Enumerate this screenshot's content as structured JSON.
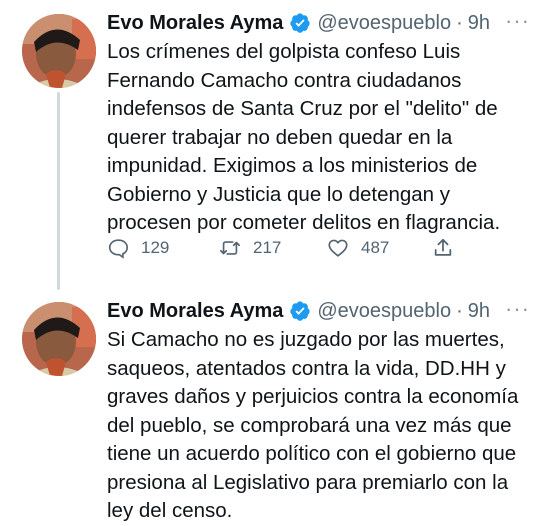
{
  "tweets": [
    {
      "author_name": "Evo Morales Ayma",
      "handle": "@evoespueblo",
      "separator": "·",
      "time": "9h",
      "more_label": "···",
      "text": "Los crímenes del golpista confeso Luis\nFernando Camacho contra ciudadanos\nindefensos de Santa Cruz por el \"delito\" de\nquerer trabajar no deben quedar en la\nimpunidad. Exigimos a los ministerios de\nGobierno y Justicia que lo detengan y\nprocesen por cometer delitos en flagrancia.",
      "replies": "129",
      "retweets": "217",
      "likes": "487"
    },
    {
      "author_name": "Evo Morales Ayma",
      "handle": "@evoespueblo",
      "separator": "·",
      "time": "9h",
      "more_label": "···",
      "text": "Si Camacho no es juzgado por las muertes,\nsaqueos, atentados contra la vida, DD.HH y\ngraves daños y perjuicios contra la economía\ndel pueblo, se comprobará una vez más que\ntiene un acuerdo político con el gobierno que\npresiona al Legislativo para premiarlo con la\nley del censo."
    }
  ],
  "icons": {
    "verified": "verified-badge-icon",
    "reply": "reply-icon",
    "retweet": "retweet-icon",
    "like": "heart-icon",
    "share": "share-icon"
  },
  "colors": {
    "text": "#0f1419",
    "secondary": "#536471",
    "verified": "#1d9bf0",
    "thread_line": "#cfd9de"
  }
}
